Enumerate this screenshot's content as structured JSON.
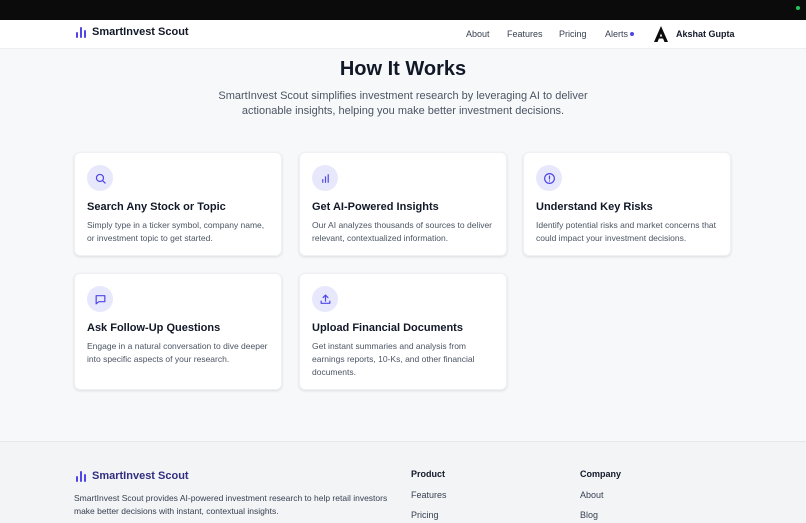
{
  "header": {
    "brand": "SmartInvest Scout",
    "nav": {
      "about": "About",
      "features": "Features",
      "pricing": "Pricing",
      "alerts": "Alerts"
    },
    "user_name": "Akshat Gupta"
  },
  "hero": {
    "title": "How It Works",
    "subtitle": "SmartInvest Scout simplifies investment research by leveraging AI to deliver actionable insights, helping you make better investment decisions."
  },
  "cards": [
    {
      "icon": "search-icon",
      "title": "Search Any Stock or Topic",
      "description": "Simply type in a ticker symbol, company name, or investment topic to get started."
    },
    {
      "icon": "bar-chart-icon",
      "title": "Get AI-Powered Insights",
      "description": "Our AI analyzes thousands of sources to deliver relevant, contextualized information."
    },
    {
      "icon": "alert-circle-icon",
      "title": "Understand Key Risks",
      "description": "Identify potential risks and market concerns that could impact your investment decisions."
    },
    {
      "icon": "chat-bubble-icon",
      "title": "Ask Follow-Up Questions",
      "description": "Engage in a natural conversation to dive deeper into specific aspects of your research."
    },
    {
      "icon": "upload-icon",
      "title": "Upload Financial Documents",
      "description": "Get instant summaries and analysis from earnings reports, 10-Ks, and other financial documents."
    }
  ],
  "footer": {
    "brand": "SmartInvest Scout",
    "description": "SmartInvest Scout provides AI-powered investment research to help retail investors make better decisions with instant, contextual insights.",
    "product": {
      "heading": "Product",
      "links": [
        "Features",
        "Pricing"
      ]
    },
    "company": {
      "heading": "Company",
      "links": [
        "About",
        "Blog"
      ]
    }
  },
  "colors": {
    "accent": "#4f46e5",
    "icon_bg": "#e7e8fb",
    "status": "#22c55e"
  }
}
